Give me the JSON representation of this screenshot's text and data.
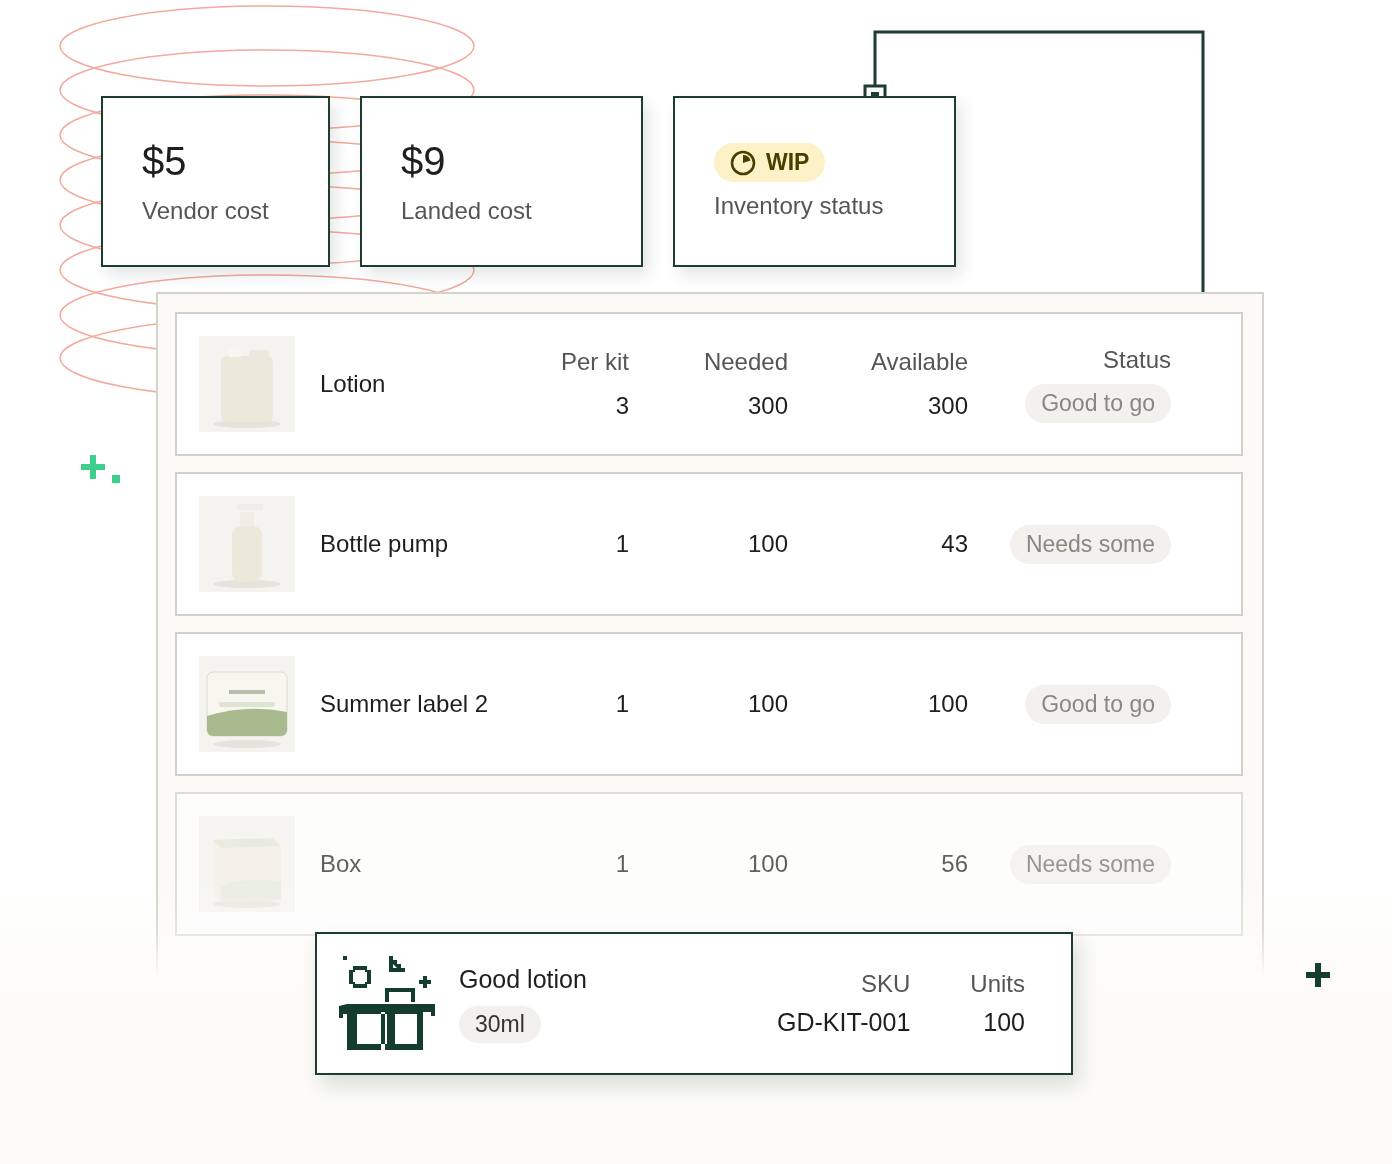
{
  "cost_cards": [
    {
      "value": "$5",
      "label": "Vendor cost"
    },
    {
      "value": "$9",
      "label": "Landed cost"
    }
  ],
  "status_card": {
    "badge": "WIP",
    "label": "Inventory status"
  },
  "components": {
    "columns": [
      "Per kit",
      "Needed",
      "Available",
      "Status"
    ],
    "rows": [
      {
        "name": "Lotion",
        "per_kit": "3",
        "needed": "300",
        "available": "300",
        "status": "Good to go",
        "dimmed": false
      },
      {
        "name": "Bottle pump",
        "per_kit": "1",
        "needed": "100",
        "available": "43",
        "status": "Needs some",
        "dimmed": false
      },
      {
        "name": "Summer label 2",
        "per_kit": "1",
        "needed": "100",
        "available": "100",
        "status": "Good to go",
        "dimmed": false
      },
      {
        "name": "Box",
        "per_kit": "1",
        "needed": "100",
        "available": "56",
        "status": "Needs some",
        "dimmed": true
      }
    ]
  },
  "kit": {
    "name": "Good lotion",
    "size": "30ml",
    "columns": [
      "SKU",
      "Units"
    ],
    "sku": "GD-KIT-001",
    "units": "100"
  }
}
